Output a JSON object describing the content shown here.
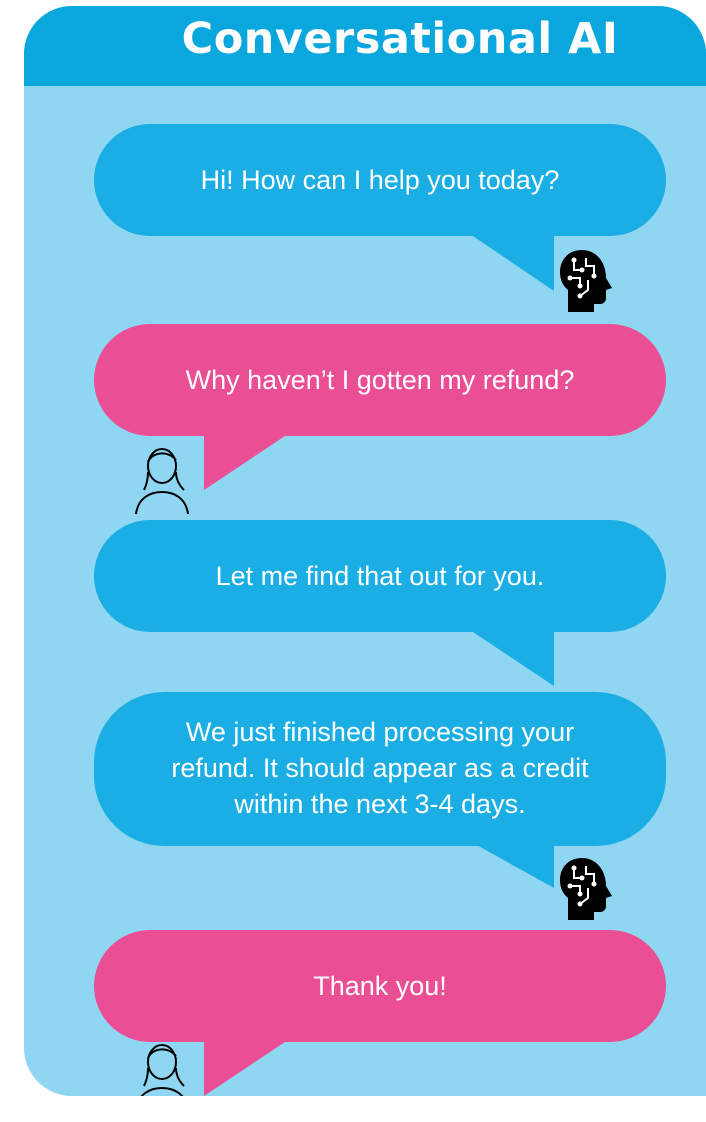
{
  "header": {
    "title": "Conversational AI"
  },
  "colors": {
    "header": "#0aa7de",
    "background": "#8fd6f3",
    "bot_bubble": "#1aaee4",
    "user_bubble": "#ea4f95"
  },
  "messages": [
    {
      "sender": "bot",
      "avatar_icon": "ai-head-icon",
      "lines": [
        "Hi! How can I help you today?"
      ]
    },
    {
      "sender": "user",
      "avatar_icon": "user-outline-icon",
      "lines": [
        "Why haven’t I gotten my refund?"
      ]
    },
    {
      "sender": "bot",
      "avatar_icon": "",
      "lines": [
        "Let me find that out for you."
      ]
    },
    {
      "sender": "bot",
      "avatar_icon": "ai-head-icon",
      "lines": [
        "We just finished processing your",
        "refund. It should appear as a credit",
        "within the next 3-4 days."
      ]
    },
    {
      "sender": "user",
      "avatar_icon": "user-outline-icon",
      "lines": [
        "Thank you!"
      ]
    }
  ]
}
